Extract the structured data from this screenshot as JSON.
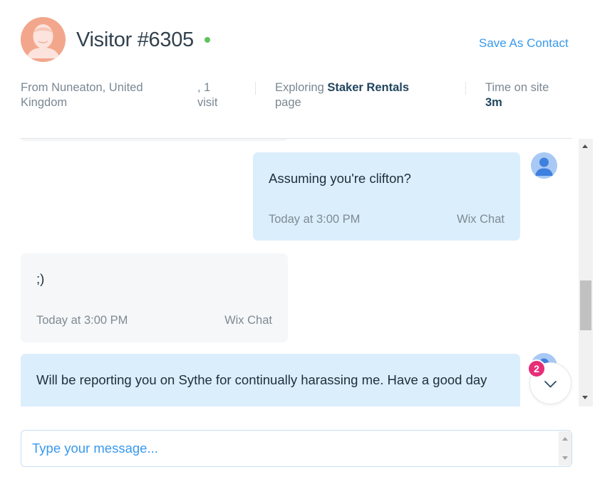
{
  "header": {
    "visitor_name": "Visitor #6305",
    "status": "online",
    "save_contact_label": "Save As Contact",
    "location_line1": "From Nuneaton, United",
    "location_line2": "Kingdom",
    "visits_line1": ", 1",
    "visits_line2": "visit",
    "exploring_prefix": "Exploring ",
    "exploring_page": "Staker Rentals",
    "exploring_suffix": "page",
    "time_label": "Time on site",
    "time_value": "3m"
  },
  "messages": [
    {
      "direction": "outgoing",
      "text": "Assuming you're clifton?",
      "time": "Today at 3:00 PM",
      "source": "Wix Chat"
    },
    {
      "direction": "incoming",
      "text": ";)",
      "time": "Today at 3:00 PM",
      "source": "Wix Chat"
    },
    {
      "direction": "outgoing",
      "text": "Will be reporting you on Sythe for continually harassing me. Have a good day"
    }
  ],
  "jump_to_latest": {
    "icon": "chevron-down-icon",
    "unread_count": "2"
  },
  "composer": {
    "placeholder": "Type your message...",
    "value": ""
  },
  "colors": {
    "accent": "#3899ec",
    "outgoing_bubble": "#dbeefc",
    "incoming_bubble": "#f5f7f9",
    "badge": "#e62e78",
    "online": "#5fc35b",
    "avatar": "#f2a78c"
  }
}
